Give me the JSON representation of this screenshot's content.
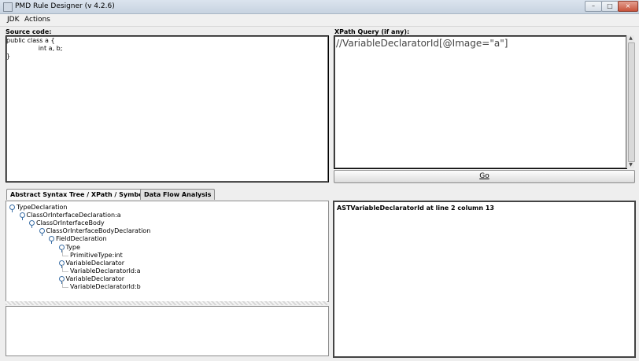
{
  "window": {
    "title": "PMD Rule Designer (v 4.2.6)",
    "controls": {
      "minimize": "–",
      "maximize": "□",
      "close": "×"
    }
  },
  "menubar": [
    "JDK",
    "Actions"
  ],
  "source": {
    "label": "Source code:",
    "lines": [
      "public class a {",
      "                int a, b;",
      "}"
    ]
  },
  "xpath": {
    "label": "XPath Query (if any):",
    "query": "//VariableDeclaratorId[@Image=\"a\"]",
    "go_label": "Go"
  },
  "tabs": [
    {
      "label": "Abstract Syntax Tree / XPath / Symbol Table",
      "active": true
    },
    {
      "label": "Data Flow Analysis",
      "active": false
    }
  ],
  "ast": [
    {
      "label": "TypeDeclaration",
      "depth": 0,
      "has_key": true
    },
    {
      "label": "ClassOrInterfaceDeclaration:a",
      "depth": 1,
      "has_key": true
    },
    {
      "label": "ClassOrInterfaceBody",
      "depth": 2,
      "has_key": true
    },
    {
      "label": "ClassOrInterfaceBodyDeclaration",
      "depth": 3,
      "has_key": true
    },
    {
      "label": "FieldDeclaration",
      "depth": 4,
      "has_key": true
    },
    {
      "label": "Type",
      "depth": 5,
      "has_key": true
    },
    {
      "label": "PrimitiveType:int",
      "depth": 6,
      "has_key": false
    },
    {
      "label": "VariableDeclarator",
      "depth": 5,
      "has_key": true
    },
    {
      "label": "VariableDeclaratorId:a",
      "depth": 6,
      "has_key": false
    },
    {
      "label": "VariableDeclarator",
      "depth": 5,
      "has_key": true
    },
    {
      "label": "VariableDeclaratorId:b",
      "depth": 6,
      "has_key": false
    }
  ],
  "result": {
    "text": "ASTVariableDeclaratorId at line 2 column 13"
  },
  "icons": {
    "tree_node": "tree-key-icon",
    "scroll_up": "arrow-up-icon",
    "scroll_down": "arrow-down-icon"
  }
}
